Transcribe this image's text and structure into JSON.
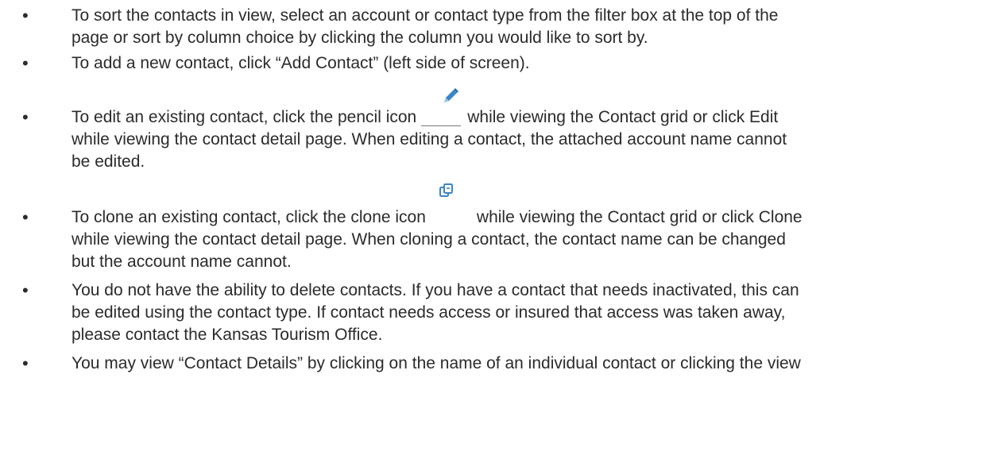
{
  "bullets": [
    {
      "lines": [
        "To sort the contacts in view, select an account or contact type from the filter box at the top of the",
        "page or sort by column choice by clicking the column you would like to sort by."
      ]
    },
    {
      "lines": [
        "To add a new contact, click “Add Contact” (left side of screen)."
      ]
    },
    {
      "line1_before_icon": "To edit an existing contact, click the pencil icon",
      "line1_after_icon": "while viewing the Contact grid or click Edit",
      "rest_lines": [
        "while viewing the contact detail page. When editing a contact, the attached account name cannot",
        "be edited."
      ]
    },
    {
      "line1_before_icon": "To clone an existing contact, click the clone icon",
      "line1_after_icon": "while viewing the Contact grid or click Clone",
      "rest_lines": [
        "while viewing the contact detail page. When cloning a contact, the contact name can be changed",
        "but the account name cannot."
      ]
    },
    {
      "lines": [
        "You do not have the ability to delete contacts. If you have a contact that needs inactivated, this can",
        "be edited using the contact type. If contact needs access or insured that access was taken away,",
        "please contact the Kansas Tourism Office."
      ]
    },
    {
      "lines": [
        "You may view “Contact Details” by clicking on the name of an individual contact or clicking the view"
      ]
    }
  ],
  "bullet_glyph": "•",
  "icons": {
    "edit": "pencil-icon",
    "clone": "clone-icon"
  },
  "colors": {
    "text": "#2b2b2b",
    "icon_blue": "#3a86c8"
  }
}
